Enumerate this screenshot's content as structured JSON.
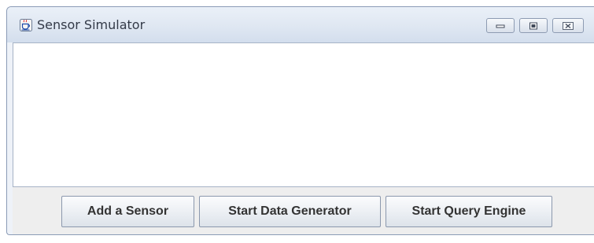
{
  "window": {
    "title": "Sensor Simulator",
    "app_icon": "java-coffee-cup-icon",
    "controls": {
      "minimize_icon": "minimize-icon",
      "maximize_icon": "maximize-icon",
      "close_icon": "close-icon"
    }
  },
  "content": {
    "text": ""
  },
  "buttons": {
    "add_sensor": "Add a Sensor",
    "start_data_generator": "Start Data Generator",
    "start_query_engine": "Start Query Engine"
  },
  "colors": {
    "titlebar": "#dfe7f2",
    "button_panel": "#eeeeee",
    "content_background": "#ffffff"
  }
}
